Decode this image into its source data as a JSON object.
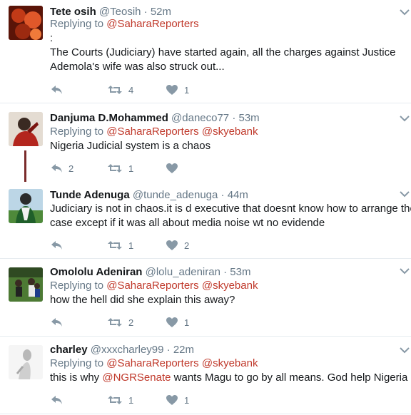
{
  "colors": {
    "mention": "#c0392b",
    "muted": "#657786",
    "thread_line": "#7a2b2b"
  },
  "tweets": [
    {
      "name": "Tete osih",
      "handle": "@Teosih",
      "time": "52m",
      "reply_prefix": "Replying to",
      "reply_mentions": [
        "@SaharaReporters"
      ],
      "text_lines": [
        ":",
        "The Courts (Judiciary) have started again, all the charges against Justice",
        "Ademola's wife was also struck out..."
      ],
      "reply_count": "",
      "retweet_count": "4",
      "like_count": "1"
    },
    {
      "name": "Danjuma D.Mohammed",
      "handle": "@daneco77",
      "time": "53m",
      "reply_prefix": "Replying to",
      "reply_mentions": [
        "@SaharaReporters",
        "@skyebank"
      ],
      "text_lines": [
        "Nigeria Judicial system is a chaos"
      ],
      "reply_count": "2",
      "retweet_count": "1",
      "like_count": ""
    },
    {
      "name": "Tunde Adenuga",
      "handle": "@tunde_adenuga",
      "time": "44m",
      "text_lines": [
        "Judiciary is not in chaos.it is d executive that doesnt know how to arrange their",
        "case except if it was all about media noise wt no evidende"
      ],
      "reply_count": "",
      "retweet_count": "1",
      "like_count": "2"
    },
    {
      "name": "Omololu Adeniran",
      "handle": "@lolu_adeniran",
      "time": "53m",
      "reply_prefix": "Replying to",
      "reply_mentions": [
        "@SaharaReporters",
        "@skyebank"
      ],
      "text_lines": [
        "how the hell did she explain this away?"
      ],
      "reply_count": "",
      "retweet_count": "2",
      "like_count": "1"
    },
    {
      "name": "charley",
      "handle": "@xxxcharley99",
      "time": "22m",
      "reply_prefix": "Replying to",
      "reply_mentions": [
        "@SaharaReporters",
        "@skyebank"
      ],
      "text_before": "this is why",
      "text_mention": "@NGRSenate",
      "text_after": "wants Magu to go by all means. God help Nigeria",
      "reply_count": "",
      "retweet_count": "1",
      "like_count": "1"
    }
  ]
}
